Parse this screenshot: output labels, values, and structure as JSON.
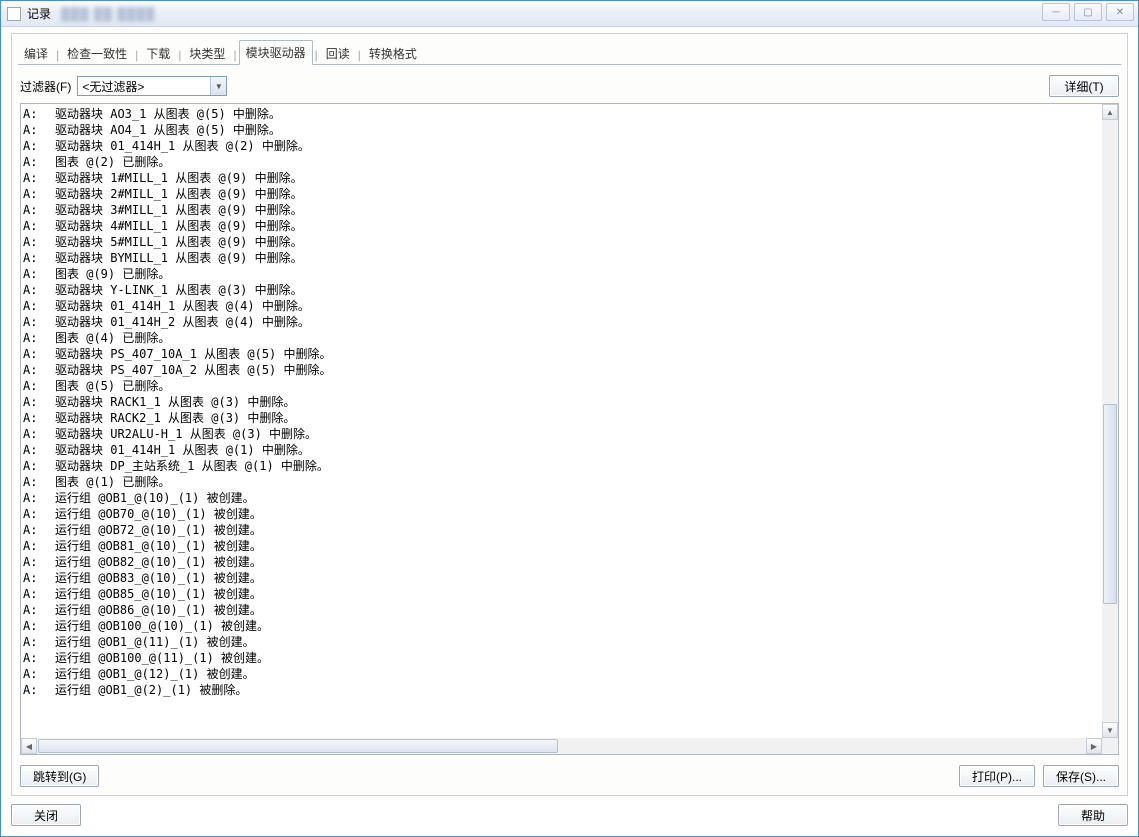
{
  "window": {
    "title": "记录",
    "min": "─",
    "max": "▢",
    "close": "✕"
  },
  "tabs": [
    {
      "label": "编译",
      "active": false
    },
    {
      "label": "检查一致性",
      "active": false
    },
    {
      "label": "下载",
      "active": false
    },
    {
      "label": "块类型",
      "active": false
    },
    {
      "label": "模块驱动器",
      "active": true
    },
    {
      "label": "回读",
      "active": false
    },
    {
      "label": "转换格式",
      "active": false
    }
  ],
  "filter": {
    "label": "过滤器(F)",
    "value": "<无过滤器>"
  },
  "buttons": {
    "detail": "详细(T)",
    "jump": "跳转到(G)",
    "print": "打印(P)...",
    "save": "保存(S)...",
    "close": "关闭",
    "help": "帮助"
  },
  "log_prefix": "A:",
  "log": [
    "驱动器块 AO3_1 从图表 @(5) 中删除。",
    "驱动器块 AO4_1 从图表 @(5) 中删除。",
    "驱动器块 01_414H_1 从图表 @(2) 中删除。",
    "图表 @(2) 已删除。",
    "驱动器块 1#MILL_1 从图表 @(9) 中删除。",
    "驱动器块 2#MILL_1 从图表 @(9) 中删除。",
    "驱动器块 3#MILL_1 从图表 @(9) 中删除。",
    "驱动器块 4#MILL_1 从图表 @(9) 中删除。",
    "驱动器块 5#MILL_1 从图表 @(9) 中删除。",
    "驱动器块 BYMILL_1 从图表 @(9) 中删除。",
    "图表 @(9) 已删除。",
    "驱动器块 Y-LINK_1 从图表 @(3) 中删除。",
    "驱动器块 01_414H_1 从图表 @(4) 中删除。",
    "驱动器块 01_414H_2 从图表 @(4) 中删除。",
    "图表 @(4) 已删除。",
    "驱动器块 PS_407_10A_1 从图表 @(5) 中删除。",
    "驱动器块 PS_407_10A_2 从图表 @(5) 中删除。",
    "图表 @(5) 已删除。",
    "驱动器块 RACK1_1 从图表 @(3) 中删除。",
    "驱动器块 RACK2_1 从图表 @(3) 中删除。",
    "驱动器块 UR2ALU-H_1 从图表 @(3) 中删除。",
    "驱动器块 01_414H_1 从图表 @(1) 中删除。",
    "驱动器块 DP_主站系统_1 从图表 @(1) 中删除。",
    "图表 @(1) 已删除。",
    "运行组 @OB1_@(10)_(1) 被创建。",
    "运行组 @OB70_@(10)_(1) 被创建。",
    "运行组 @OB72_@(10)_(1) 被创建。",
    "运行组 @OB81_@(10)_(1) 被创建。",
    "运行组 @OB82_@(10)_(1) 被创建。",
    "运行组 @OB83_@(10)_(1) 被创建。",
    "运行组 @OB85_@(10)_(1) 被创建。",
    "运行组 @OB86_@(10)_(1) 被创建。",
    "运行组 @OB100_@(10)_(1) 被创建。",
    "运行组 @OB1_@(11)_(1) 被创建。",
    "运行组 @OB100_@(11)_(1) 被创建。",
    "运行组 @OB1_@(12)_(1) 被创建。",
    "运行组 @OB1_@(2)_(1) 被删除。"
  ]
}
